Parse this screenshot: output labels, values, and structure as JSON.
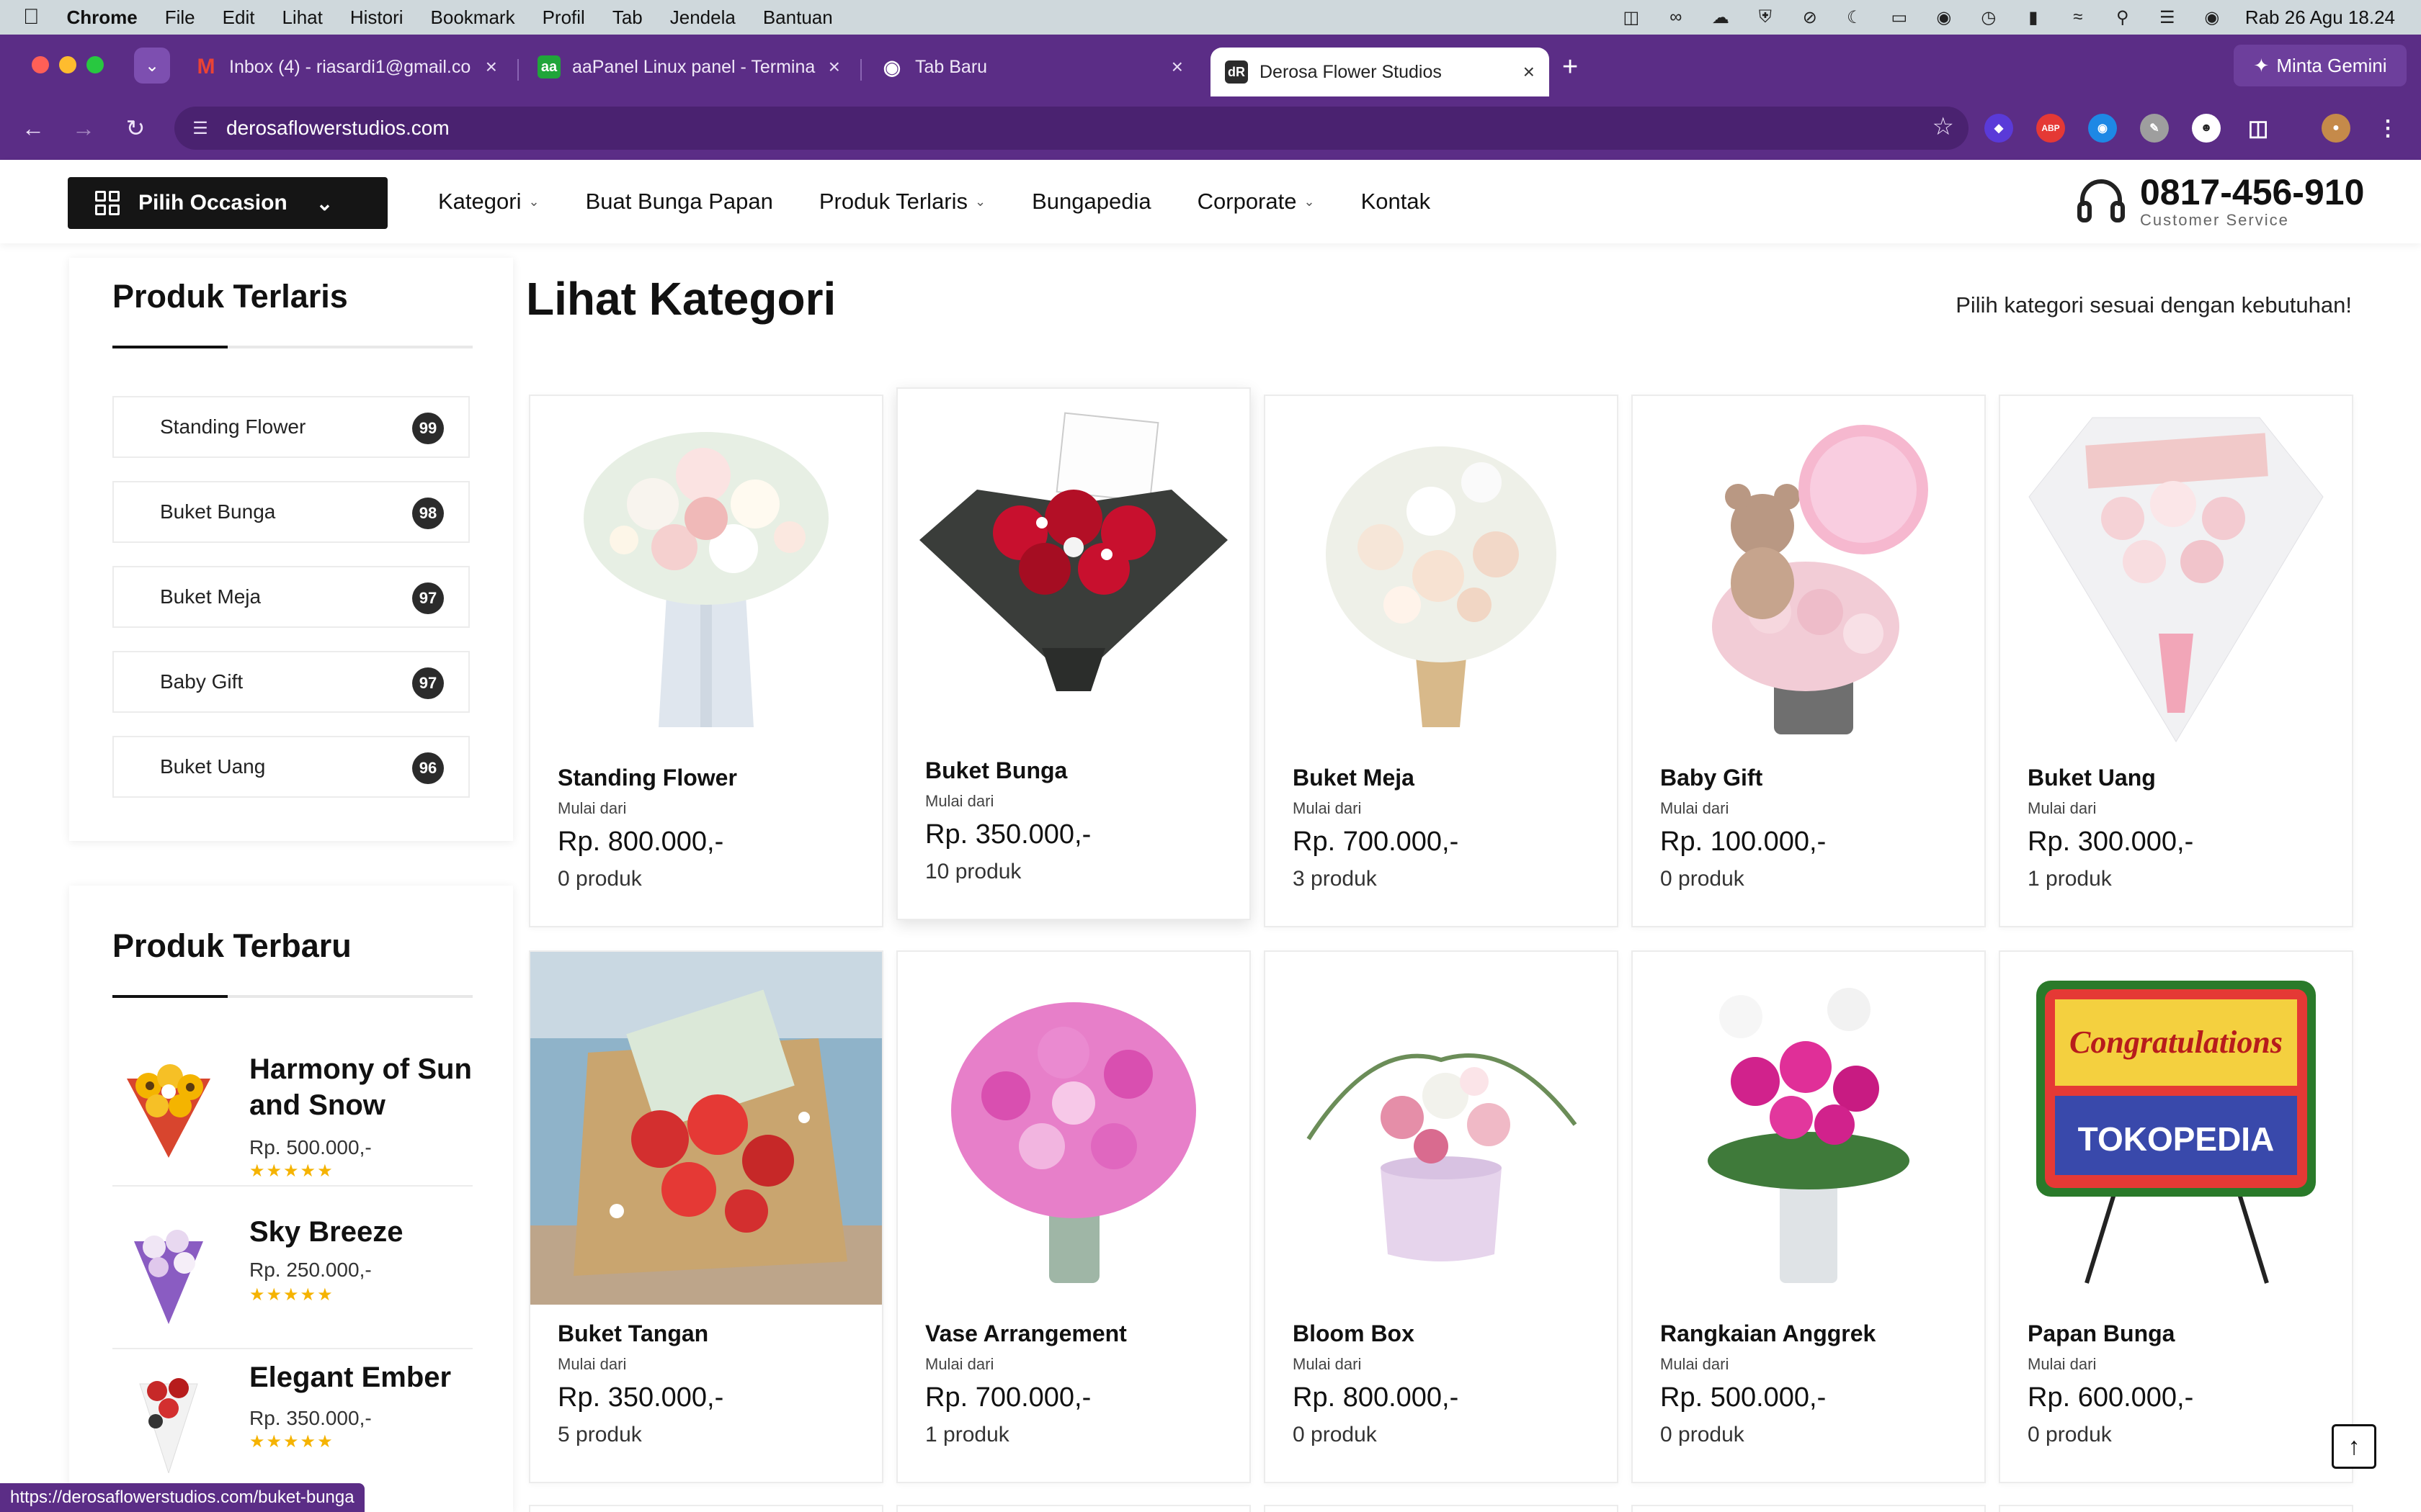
{
  "os_menubar": {
    "items": [
      "Chrome",
      "File",
      "Edit",
      "Lihat",
      "Histori",
      "Bookmark",
      "Profil",
      "Tab",
      "Jendela",
      "Bantuan"
    ],
    "clock": "Rab 26 Agu  18.24"
  },
  "browser": {
    "tabs": [
      {
        "title": "Inbox (4) - riasardi1@gmail.co",
        "favicon": "gmail-icon"
      },
      {
        "title": "aaPanel Linux panel - Termina",
        "favicon": "aapanel-icon"
      },
      {
        "title": "Tab Baru",
        "favicon": "chrome-icon"
      },
      {
        "title": "Derosa Flower Studios",
        "favicon": "derosa-icon"
      }
    ],
    "favicon_text": {
      "aapanel": "aa",
      "derosa": "dR"
    },
    "gemini_label": "Minta Gemini",
    "url": "derosaflowerstudios.com",
    "status_url": "https://derosaflowerstudios.com/buket-bunga",
    "extensions": {
      "adblock": "ABP"
    }
  },
  "header": {
    "occasion_label": "Pilih Occasion",
    "nav": [
      {
        "label": "Kategori",
        "has_dropdown": true
      },
      {
        "label": "Buat Bunga Papan",
        "has_dropdown": false
      },
      {
        "label": "Produk Terlaris",
        "has_dropdown": true
      },
      {
        "label": "Bungapedia",
        "has_dropdown": false
      },
      {
        "label": "Corporate",
        "has_dropdown": true
      },
      {
        "label": "Kontak",
        "has_dropdown": false
      }
    ],
    "phone": "0817-456-910",
    "phone_caption": "Customer Service"
  },
  "sidebar": {
    "bestseller_title": "Produk Terlaris",
    "bestsellers": [
      {
        "name": "Standing Flower",
        "count": "99"
      },
      {
        "name": "Buket Bunga",
        "count": "98"
      },
      {
        "name": "Buket Meja",
        "count": "97"
      },
      {
        "name": "Baby Gift",
        "count": "97"
      },
      {
        "name": "Buket Uang",
        "count": "96"
      }
    ],
    "newest_title": "Produk Terbaru",
    "newest": [
      {
        "name": "Harmony of Sun and Snow",
        "price": "Rp. 500.000,-",
        "rating": 5
      },
      {
        "name": "Sky Breeze",
        "price": "Rp. 250.000,-",
        "rating": 5
      },
      {
        "name": "Elegant Ember",
        "price": "Rp. 350.000,-",
        "rating": 5
      }
    ]
  },
  "main": {
    "title": "Lihat Kategori",
    "subtitle": "Pilih kategori sesuai dengan kebutuhan!",
    "from_label": "Mulai dari",
    "categories": [
      {
        "name": "Standing Flower",
        "price": "Rp. 800.000,-",
        "count": "0 produk"
      },
      {
        "name": "Buket Bunga",
        "price": "Rp. 350.000,-",
        "count": "10 produk"
      },
      {
        "name": "Buket Meja",
        "price": "Rp. 700.000,-",
        "count": "3 produk"
      },
      {
        "name": "Baby Gift",
        "price": "Rp. 100.000,-",
        "count": "0 produk"
      },
      {
        "name": "Buket Uang",
        "price": "Rp. 300.000,-",
        "count": "1 produk"
      },
      {
        "name": "Buket Tangan",
        "price": "Rp. 350.000,-",
        "count": "5 produk"
      },
      {
        "name": "Vase Arrangement",
        "price": "Rp. 700.000,-",
        "count": "1 produk"
      },
      {
        "name": "Bloom Box",
        "price": "Rp. 800.000,-",
        "count": "0 produk"
      },
      {
        "name": "Rangkaian Anggrek",
        "price": "Rp. 500.000,-",
        "count": "0 produk"
      },
      {
        "name": "Papan Bunga",
        "price": "Rp. 600.000,-",
        "count": "0 produk"
      }
    ],
    "papan_banner_text": "TOKOPEDIA",
    "papan_banner_sub": "Congratulations"
  },
  "colors": {
    "browser_chrome": "#5b2d86",
    "dark_button": "#151515",
    "badge": "#2b2b2b",
    "star": "#f5b301"
  }
}
